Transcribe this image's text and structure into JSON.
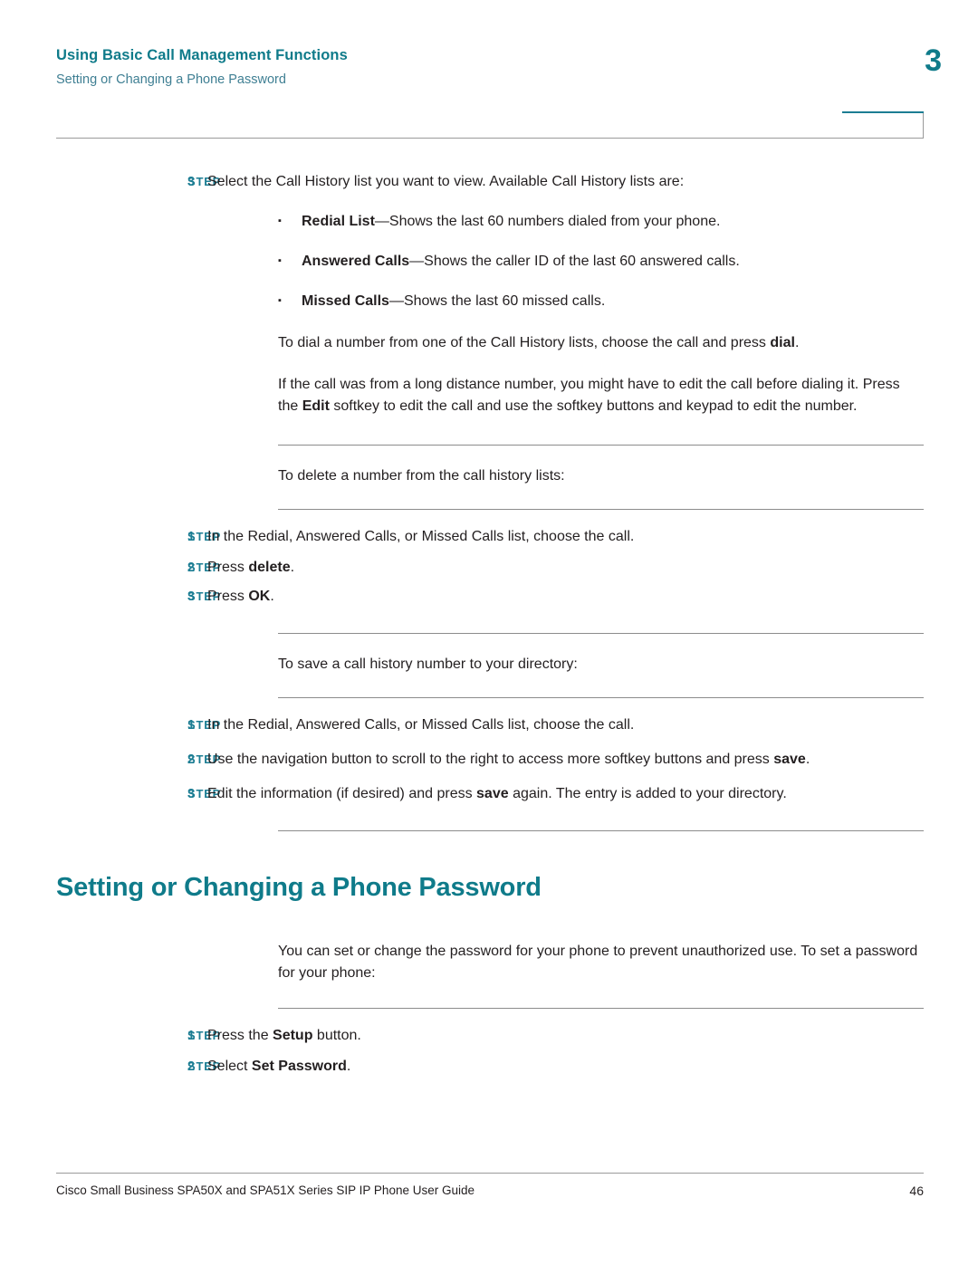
{
  "header": {
    "title": "Using Basic Call Management Functions",
    "subtitle": "Setting or Changing a Phone Password",
    "chapter": "3"
  },
  "blocks": {
    "step3_label": "STEP",
    "step3_num": "3",
    "step3_text": "Select the Call History list you want to view. Available Call History lists are:",
    "bullet_mark": "▪",
    "bullet1_bold": "Redial List",
    "bullet1_rest": "—Shows the last 60 numbers dialed from your phone.",
    "bullet2_bold": "Answered Calls",
    "bullet2_rest": "—Shows the caller ID of the last 60 answered calls.",
    "bullet3_bold": "Missed Calls",
    "bullet3_rest": "—Shows the last 60 missed calls.",
    "para_dial_pre": "To dial a number from one of the Call History lists, choose the call and press ",
    "para_dial_bold": "dial",
    "para_dial_post": ".",
    "para_edit_pre": "If the call was from a long distance number, you might have to edit the call before dialing it. Press the ",
    "para_edit_bold": "Edit",
    "para_edit_post": " softkey to edit the call and use the softkey buttons and keypad to edit the number.",
    "intro_delete": "To delete a number from the call history lists:",
    "del_step1_label": "STEP",
    "del_step1_num": "1",
    "del_step1_text": "In the Redial, Answered Calls, or Missed Calls list, choose the call.",
    "del_step2_label": "STEP",
    "del_step2_num": "2",
    "del_step2_pre": "Press ",
    "del_step2_bold": "delete",
    "del_step2_post": ".",
    "del_step3_label": "STEP",
    "del_step3_num": "3",
    "del_step3_pre": "Press ",
    "del_step3_bold": "OK",
    "del_step3_post": ".",
    "intro_save": "To save a call history number to your directory:",
    "save_step1_label": "STEP",
    "save_step1_num": "1",
    "save_step1_text": "In the Redial, Answered Calls, or Missed Calls list, choose the call.",
    "save_step2_label": "STEP",
    "save_step2_num": "2",
    "save_step2_pre": "Use the navigation button to scroll to the right to access more softkey buttons and press ",
    "save_step2_bold": "save",
    "save_step2_post": ".",
    "save_step3_label": "STEP",
    "save_step3_num": "3",
    "save_step3_pre": "Edit the information (if desired) and press ",
    "save_step3_bold": "save",
    "save_step3_post": " again. The entry is added to your directory.",
    "section_title": "Setting or Changing a Phone Password",
    "pw_intro": "You can set or change the password for your phone to prevent unauthorized use. To set a password for your phone:",
    "pw_step1_label": "STEP",
    "pw_step1_num": "1",
    "pw_step1_pre": "Press the ",
    "pw_step1_bold": "Setup",
    "pw_step1_post": " button.",
    "pw_step2_label": "STEP",
    "pw_step2_num": "2",
    "pw_step2_pre": "Select ",
    "pw_step2_bold": "Set Password",
    "pw_step2_post": "."
  },
  "footer": {
    "text": "Cisco Small Business SPA50X and SPA51X Series SIP IP Phone User Guide",
    "page": "46"
  },
  "colors": {
    "accent": "#0f7b8a",
    "step_label": "#1c7d93",
    "body_text": "#231f20"
  }
}
